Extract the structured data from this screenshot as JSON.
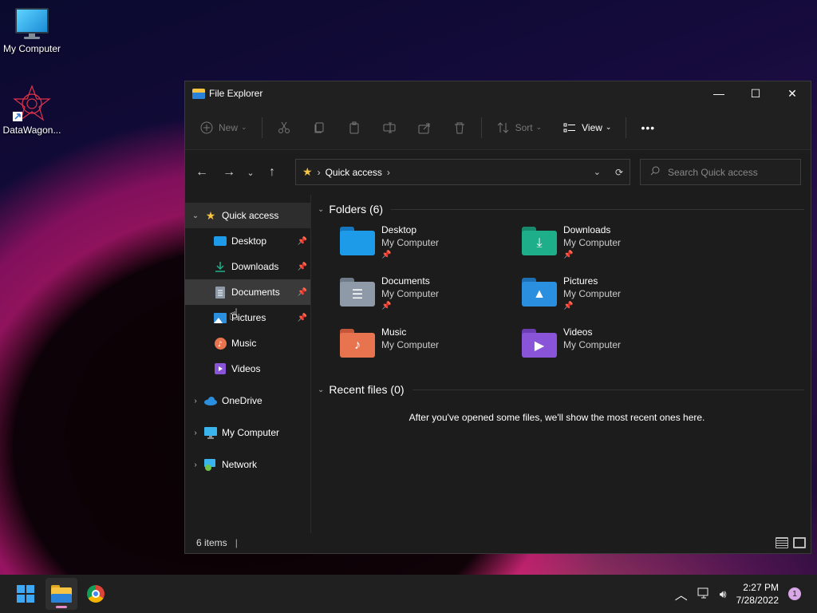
{
  "desktop": {
    "icons": [
      {
        "label": "My Computer"
      },
      {
        "label": "DataWagon..."
      }
    ]
  },
  "window": {
    "title": "File Explorer",
    "controls": {
      "minimize": "—",
      "maximize": "☐",
      "close": "✕"
    }
  },
  "toolbar": {
    "new_label": "New",
    "sort_label": "Sort",
    "view_label": "View",
    "more_label": "•••"
  },
  "address": {
    "crumb": "Quick access"
  },
  "search": {
    "placeholder": "Search Quick access"
  },
  "sidebar": {
    "quick_access": "Quick access",
    "items": [
      {
        "label": "Desktop",
        "pinned": true
      },
      {
        "label": "Downloads",
        "pinned": true
      },
      {
        "label": "Documents",
        "pinned": true
      },
      {
        "label": "Pictures",
        "pinned": true
      },
      {
        "label": "Music",
        "pinned": false
      },
      {
        "label": "Videos",
        "pinned": false
      }
    ],
    "onedrive": "OneDrive",
    "my_computer": "My Computer",
    "network": "Network"
  },
  "content": {
    "folders_header": "Folders (6)",
    "folders": [
      {
        "name": "Desktop",
        "location": "My Computer",
        "pinned": true,
        "color": "#1e9be8"
      },
      {
        "name": "Downloads",
        "location": "My Computer",
        "pinned": true,
        "color": "#1fae8a"
      },
      {
        "name": "Documents",
        "location": "My Computer",
        "pinned": true,
        "color": "#8e9aa8"
      },
      {
        "name": "Pictures",
        "location": "My Computer",
        "pinned": true,
        "color": "#2b8fe0"
      },
      {
        "name": "Music",
        "location": "My Computer",
        "pinned": false,
        "color": "#e8734f"
      },
      {
        "name": "Videos",
        "location": "My Computer",
        "pinned": false,
        "color": "#8a54d8"
      }
    ],
    "recent_header": "Recent files (0)",
    "recent_message": "After you've opened some files, we'll show the most recent ones here."
  },
  "status": {
    "items": "6 items"
  },
  "taskbar": {
    "time": "2:27 PM",
    "date": "7/28/2022",
    "notifications": "1"
  }
}
